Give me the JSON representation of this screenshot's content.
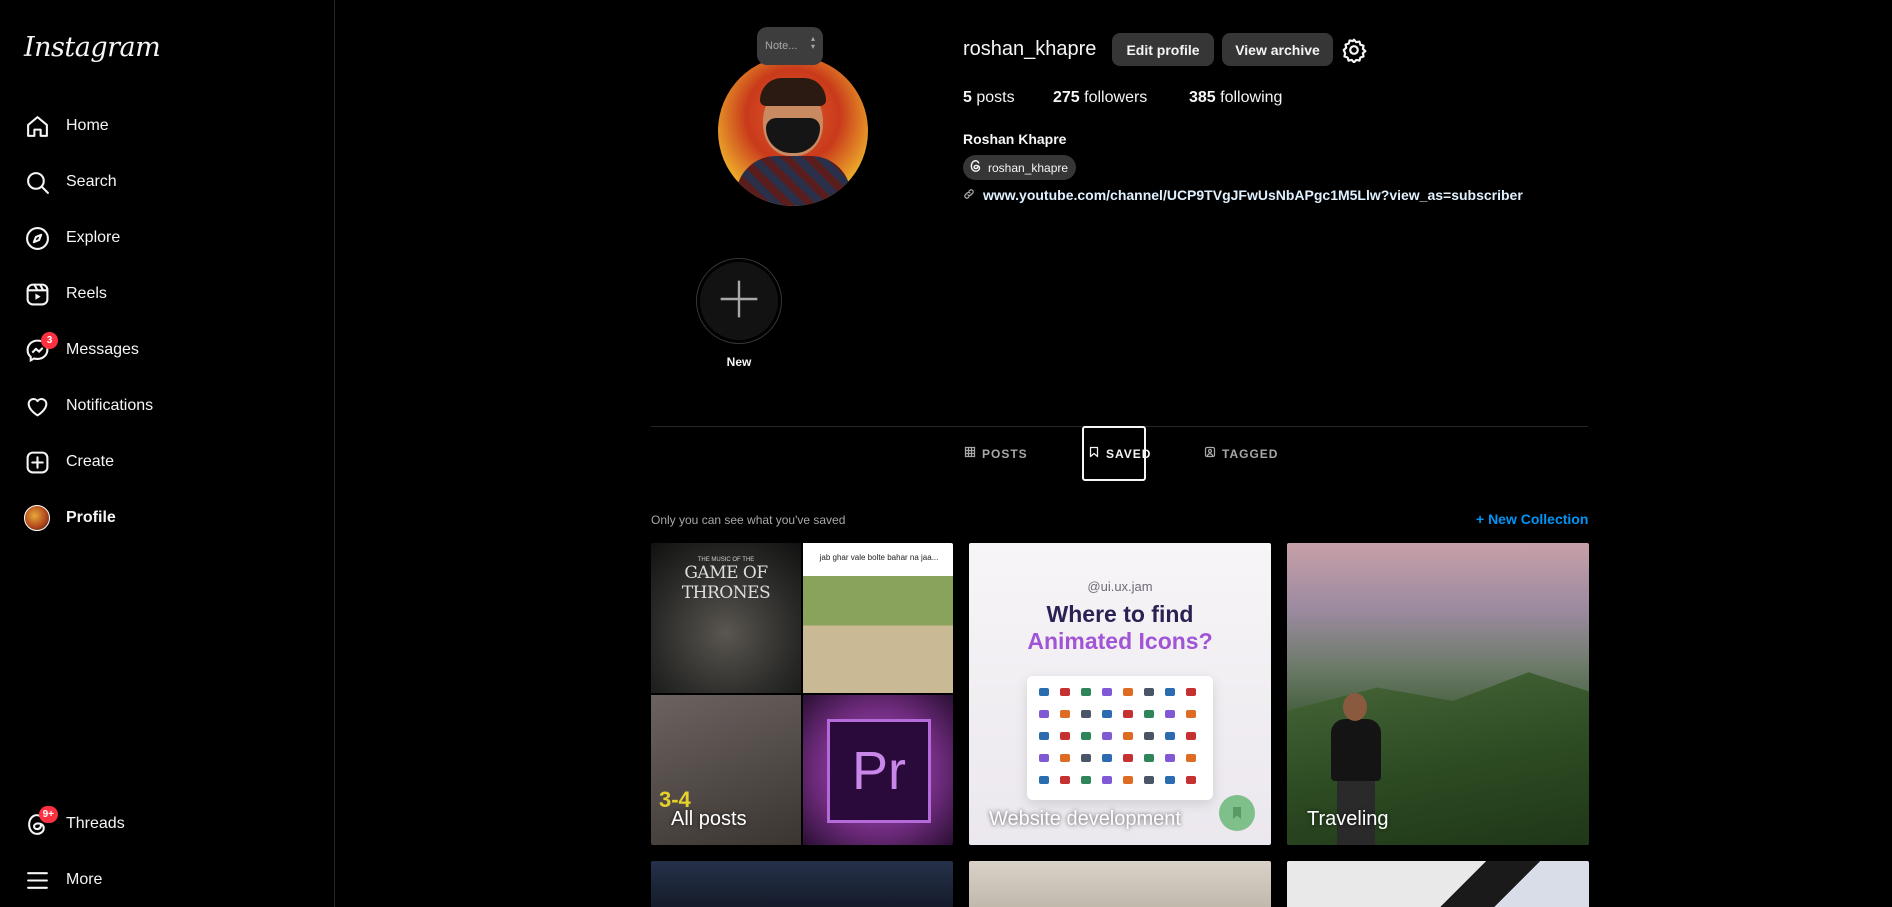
{
  "app": {
    "logo_text": "Instagram"
  },
  "sidebar": {
    "items": [
      {
        "label": "Home",
        "icon": "home-icon"
      },
      {
        "label": "Search",
        "icon": "search-icon"
      },
      {
        "label": "Explore",
        "icon": "compass-icon"
      },
      {
        "label": "Reels",
        "icon": "reels-icon"
      },
      {
        "label": "Messages",
        "icon": "messenger-icon",
        "badge": "3"
      },
      {
        "label": "Notifications",
        "icon": "heart-icon"
      },
      {
        "label": "Create",
        "icon": "plus-square-icon"
      },
      {
        "label": "Profile",
        "icon": "avatar"
      }
    ],
    "bottom": [
      {
        "label": "Threads",
        "icon": "threads-icon",
        "badge": "9+"
      },
      {
        "label": "More",
        "icon": "hamburger-icon"
      }
    ]
  },
  "profile": {
    "note_placeholder": "Note...",
    "username": "roshan_khapre",
    "edit_profile": "Edit profile",
    "view_archive": "View archive",
    "posts_count": "5",
    "posts_label": "posts",
    "followers_count": "275",
    "followers_label": "followers",
    "following_count": "385",
    "following_label": "following",
    "full_name": "Roshan Khapre",
    "threads_handle": "roshan_khapre",
    "link": "www.youtube.com/channel/UCP9TVgJFwUsNbAPgc1M5Llw?view_as=subscriber"
  },
  "highlights": {
    "new_label": "New"
  },
  "tabs": [
    {
      "label": "POSTS",
      "icon": "grid-icon",
      "active": false
    },
    {
      "label": "SAVED",
      "icon": "bookmark-icon",
      "active": true
    },
    {
      "label": "TAGGED",
      "icon": "tag-person-icon",
      "active": false
    }
  ],
  "saved": {
    "note": "Only you can see what you've saved",
    "new_collection": "+ New Collection",
    "collections": [
      {
        "title": "All posts"
      },
      {
        "title": "Website development"
      },
      {
        "title": "Traveling"
      }
    ],
    "thumb_text": {
      "got_top": "THE MUSIC OF THE",
      "got_title": "GAME OF THRONES",
      "q2_caption": "jab ghar vale bolte bahar na jaa...",
      "q3_text": "3-4",
      "pr": "Pr",
      "t2_handle": "@ui.ux.jam",
      "t2_line1": "Where to find",
      "t2_line2": "Animated Icons?"
    }
  },
  "colors": {
    "accent_blue": "#0095f6",
    "badge_red": "#ff3040",
    "button_gray": "#363636",
    "t2_dark": "#2d2153",
    "t2_purple": "#a155d6"
  }
}
